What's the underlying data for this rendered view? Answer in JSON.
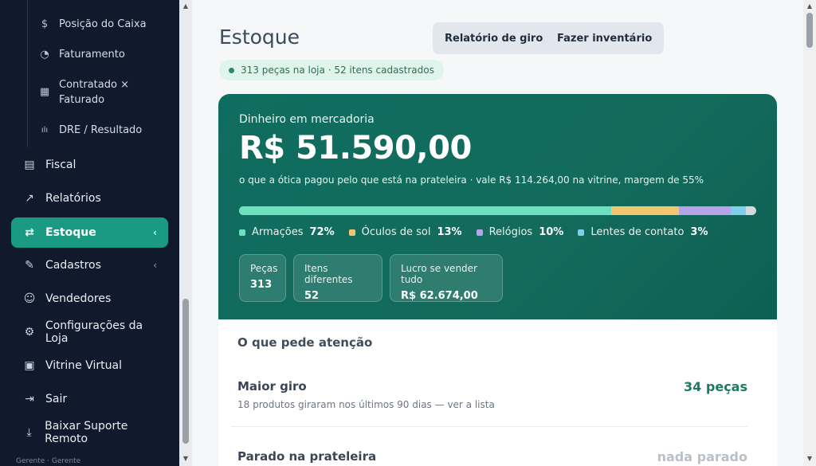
{
  "sidebar": {
    "sub_items": [
      {
        "icon": "dollar-icon",
        "glyph": "$",
        "label": "Posição do Caixa"
      },
      {
        "icon": "pie-chart-icon",
        "glyph": "◔",
        "label": "Faturamento"
      },
      {
        "icon": "table-icon",
        "glyph": "▦",
        "label": "Contratado × Faturado"
      },
      {
        "icon": "bar-chart-icon",
        "glyph": "ılı",
        "label": "DRE / Resultado"
      }
    ],
    "items": [
      {
        "icon": "document-icon",
        "glyph": "▤",
        "label": "Fiscal",
        "chevron": ""
      },
      {
        "icon": "line-chart-icon",
        "glyph": "↗",
        "label": "Relatórios",
        "chevron": ""
      },
      {
        "icon": "swap-icon",
        "glyph": "⇄",
        "label": "Estoque",
        "chevron": "‹",
        "active": true
      },
      {
        "icon": "edit-icon",
        "glyph": "✎",
        "label": "Cadastros",
        "chevron": "‹"
      },
      {
        "icon": "user-check-icon",
        "glyph": "☺",
        "label": "Vendedores",
        "chevron": ""
      },
      {
        "icon": "gear-icon",
        "glyph": "⚙",
        "label": "Configurações da Loja",
        "chevron": ""
      },
      {
        "icon": "layout-icon",
        "glyph": "▣",
        "label": "Vitrine Virtual",
        "chevron": ""
      },
      {
        "icon": "logout-icon",
        "glyph": "⇥",
        "label": "Sair",
        "chevron": ""
      },
      {
        "icon": "download-icon",
        "glyph": "⤓",
        "label": "Baixar Suporte Remoto",
        "chevron": ""
      }
    ],
    "footer": "Gerente · Gerente"
  },
  "header": {
    "title": "Estoque",
    "buttons": [
      "Relatório de giro",
      "Fazer inventário"
    ],
    "summary_pill": "313 peças na loja · 52 itens cadastrados"
  },
  "hero": {
    "label": "Dinheiro em mercadoria",
    "value": "R$ 51.590,00",
    "subtitle": "o que a ótica pagou pelo que está na prateleira · vale R$ 114.264,00 na vitrine, margem de 55%",
    "breakdown": [
      {
        "name": "Armações",
        "pct_label": "72%",
        "share": 72,
        "color": "#6ee0c0"
      },
      {
        "name": "Óculos de sol",
        "pct_label": "13%",
        "share": 13,
        "color": "#f2c66d"
      },
      {
        "name": "Relógios",
        "pct_label": "10%",
        "share": 10,
        "color": "#b6a3e8"
      },
      {
        "name": "Lentes de contato",
        "pct_label": "3%",
        "share": 3,
        "color": "#7cd0ea"
      }
    ],
    "stats": [
      {
        "label": "Peças",
        "value": "313"
      },
      {
        "label": "Itens diferentes",
        "value": "52"
      },
      {
        "label": "Lucro se vender tudo",
        "value": "R$ 62.674,00"
      }
    ]
  },
  "attention": {
    "title": "O que pede atenção",
    "rows": [
      {
        "name": "Maior giro",
        "desc": "18 produtos giraram nos últimos 90 dias — ver a lista",
        "value": "34 peças"
      },
      {
        "name": "Parado na prateleira",
        "desc": "",
        "value": "nada parado"
      }
    ]
  }
}
